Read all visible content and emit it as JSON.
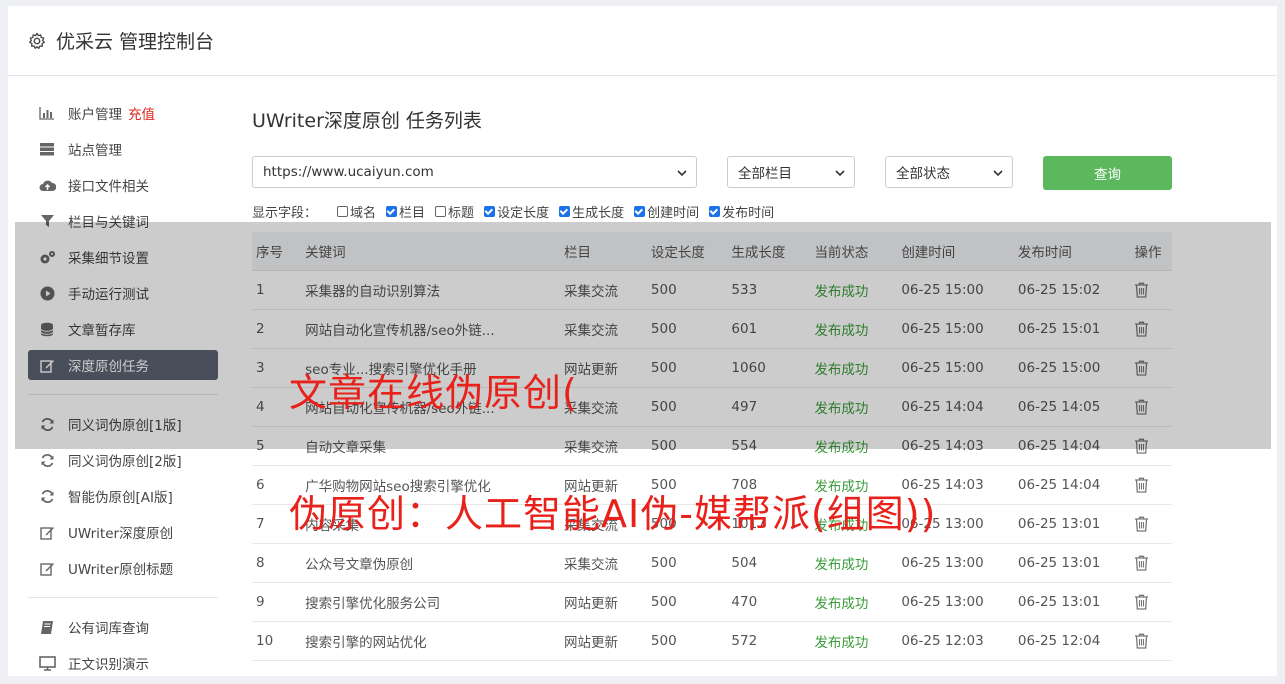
{
  "header": {
    "title": "优采云 管理控制台"
  },
  "sidebar": {
    "group1": [
      {
        "icon": "bar-chart-icon",
        "label": "账户管理",
        "tag": "充值"
      },
      {
        "icon": "server-icon",
        "label": "站点管理"
      },
      {
        "icon": "cloud-upload-icon",
        "label": "接口文件相关"
      },
      {
        "icon": "filter-icon",
        "label": "栏目与关键词"
      },
      {
        "icon": "gears-icon",
        "label": "采集细节设置"
      },
      {
        "icon": "play-icon",
        "label": "手动运行测试"
      },
      {
        "icon": "database-icon",
        "label": "文章暂存库"
      },
      {
        "icon": "edit-icon",
        "label": "深度原创任务",
        "active": true
      }
    ],
    "group2": [
      {
        "icon": "refresh-icon",
        "label": "同义词伪原创[1版]"
      },
      {
        "icon": "refresh-icon",
        "label": "同义词伪原创[2版]"
      },
      {
        "icon": "refresh-icon",
        "label": "智能伪原创[AI版]"
      },
      {
        "icon": "edit-icon",
        "label": "UWriter深度原创"
      },
      {
        "icon": "edit-icon",
        "label": "UWriter原创标题"
      }
    ],
    "group3": [
      {
        "icon": "book-icon",
        "label": "公有词库查询"
      },
      {
        "icon": "monitor-icon",
        "label": "正文识别演示"
      }
    ]
  },
  "main": {
    "title": "UWriter深度原创 任务列表",
    "site_select": "https://www.ucaiyun.com",
    "column_select": "全部栏目",
    "status_select": "全部状态",
    "query_label": "查询",
    "fields_label": "显示字段：",
    "fields": [
      {
        "label": "域名",
        "checked": false
      },
      {
        "label": "栏目",
        "checked": true
      },
      {
        "label": "标题",
        "checked": false
      },
      {
        "label": "设定长度",
        "checked": true
      },
      {
        "label": "生成长度",
        "checked": true
      },
      {
        "label": "创建时间",
        "checked": true
      },
      {
        "label": "发布时间",
        "checked": true
      }
    ],
    "table": {
      "headers": [
        "序号",
        "关键词",
        "栏目",
        "设定长度",
        "生成长度",
        "当前状态",
        "创建时间",
        "发布时间",
        "操作"
      ],
      "rows": [
        [
          "1",
          "采集器的自动识别算法",
          "采集交流",
          "500",
          "533",
          "发布成功",
          "06-25 15:00",
          "06-25 15:02"
        ],
        [
          "2",
          "网站自动化宣传机器/seo外链...",
          "采集交流",
          "500",
          "601",
          "发布成功",
          "06-25 15:00",
          "06-25 15:01"
        ],
        [
          "3",
          "seo专业...搜索引擎优化手册",
          "网站更新",
          "500",
          "1060",
          "发布成功",
          "06-25 15:00",
          "06-25 15:00"
        ],
        [
          "4",
          "网站自动化宣传机器/seo外链...",
          "采集交流",
          "500",
          "497",
          "发布成功",
          "06-25 14:04",
          "06-25 14:05"
        ],
        [
          "5",
          "自动文章采集",
          "采集交流",
          "500",
          "554",
          "发布成功",
          "06-25 14:03",
          "06-25 14:04"
        ],
        [
          "6",
          "广华购物网站seo搜索引擎优化",
          "网站更新",
          "500",
          "708",
          "发布成功",
          "06-25 14:03",
          "06-25 14:04"
        ],
        [
          "7",
          "内容采集",
          "采集交流",
          "500",
          "1017",
          "发布成功",
          "06-25 13:00",
          "06-25 13:01"
        ],
        [
          "8",
          "公众号文章伪原创",
          "采集交流",
          "500",
          "504",
          "发布成功",
          "06-25 13:00",
          "06-25 13:01"
        ],
        [
          "9",
          "搜索引擎优化服务公司",
          "网站更新",
          "500",
          "470",
          "发布成功",
          "06-25 13:00",
          "06-25 13:01"
        ],
        [
          "10",
          "搜索引擎的网站优化",
          "网站更新",
          "500",
          "572",
          "发布成功",
          "06-25 12:03",
          "06-25 12:04"
        ]
      ]
    }
  },
  "overlay": {
    "line1": "文章在线伪原创(",
    "line2": "伪原创：人工智能AI伪-媒帮派(组图))"
  },
  "colors": {
    "accent_green": "#5cb85c",
    "status_green": "#3a9b3a",
    "overlay_red": "#e8211b",
    "active_nav": "#5c6272"
  }
}
